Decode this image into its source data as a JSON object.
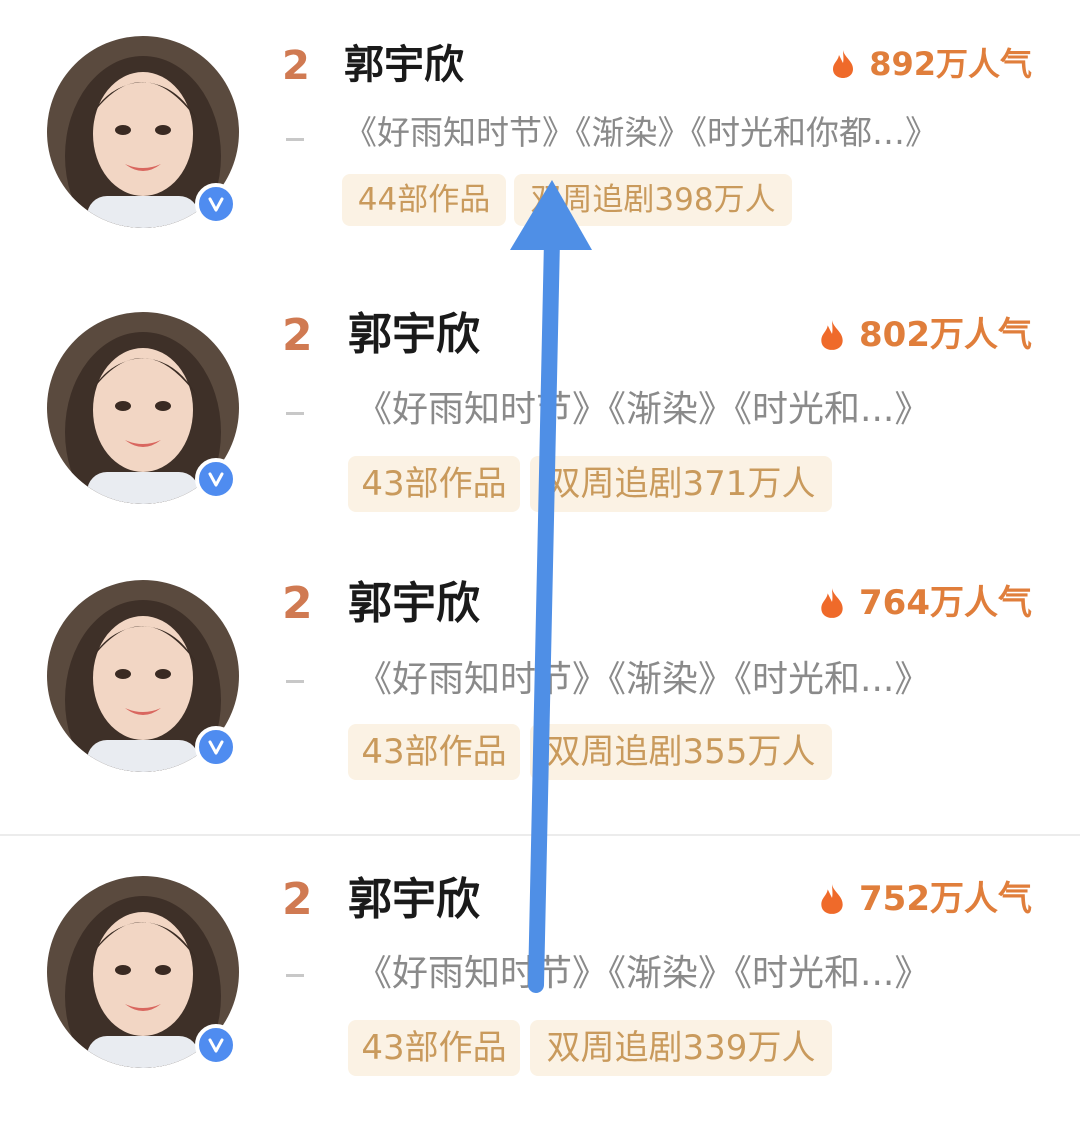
{
  "rows": [
    {
      "rank": "2",
      "name": "郭宇欣",
      "popularity": "892万人气",
      "dash": "–",
      "works": "《好雨知时节》《渐染》《时光和你都…》",
      "tag_works": "44部作品",
      "tag_follow": "双周追剧398万人"
    },
    {
      "rank": "2",
      "name": "郭宇欣",
      "popularity": "802万人气",
      "dash": "–",
      "works": "《好雨知时节》《渐染》《时光和...》",
      "tag_works": "43部作品",
      "tag_follow": "双周追剧371万人"
    },
    {
      "rank": "2",
      "name": "郭宇欣",
      "popularity": "764万人气",
      "dash": "–",
      "works": "《好雨知时节》《渐染》《时光和...》",
      "tag_works": "43部作品",
      "tag_follow": "双周追剧355万人"
    },
    {
      "rank": "2",
      "name": "郭宇欣",
      "popularity": "752万人气",
      "dash": "–",
      "works": "《好雨知时节》《渐染》《时光和...》",
      "tag_works": "43部作品",
      "tag_follow": "双周追剧339万人"
    }
  ],
  "icons": {
    "avatar": "avatar-photo",
    "verified": "verified-v-badge-icon",
    "popularity": "flame-icon",
    "overlay": "up-arrow-annotation"
  },
  "colors": {
    "rank": "#d07a52",
    "popularity": "#e07e3b",
    "tag_bg": "#fbf2e4",
    "tag_text": "#c99a5c",
    "verified_badge": "#4f8cf0",
    "arrow": "#4f8fe6"
  }
}
